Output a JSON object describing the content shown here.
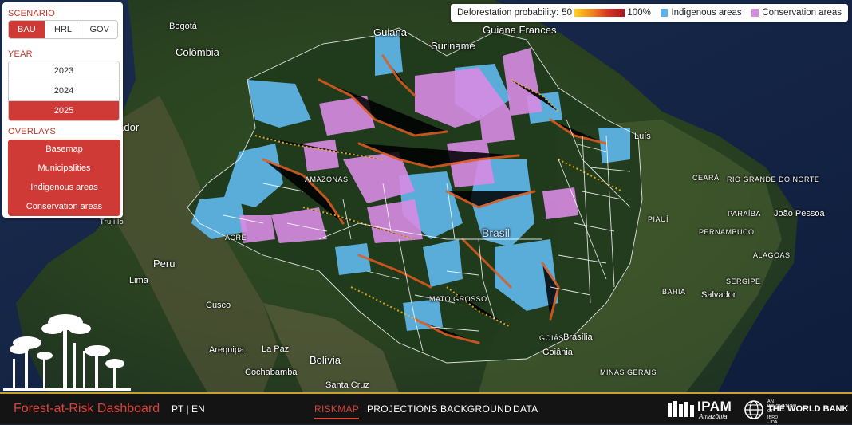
{
  "panel": {
    "scenario": {
      "title": "SCENARIO",
      "options": [
        "BAU",
        "HRL",
        "GOV"
      ],
      "selected": "BAU"
    },
    "year": {
      "title": "YEAR",
      "options": [
        "2023",
        "2024",
        "2025"
      ],
      "selected": "2025"
    },
    "overlays": {
      "title": "OVERLAYS",
      "items": [
        "Basemap",
        "Municipalities",
        "Indigenous areas",
        "Conservation areas"
      ]
    }
  },
  "legend": {
    "label": "Deforestation probability:",
    "min": "50",
    "max": "100%",
    "indigenous": "Indigenous areas",
    "conservation": "Conservation areas",
    "colors": {
      "low": "#ffd21a",
      "mid": "#f28a1e",
      "high": "#a8161c",
      "indigenous": "#5eb3e4",
      "conservation": "#d98be3"
    }
  },
  "map_labels": {
    "guiana": "Guiana",
    "suriname": "Suriname",
    "guiana_francesa": "Guiana Frances",
    "bogota": "Bogotá",
    "colombia": "Colômbia",
    "equador": "Equador",
    "peru": "Peru",
    "lima": "Lima",
    "cusco": "Cusco",
    "arequipa": "Arequipa",
    "la_paz": "La Paz",
    "bolivia": "Bolívia",
    "cochabamba": "Cochabamba",
    "santa_cruz": "Santa Cruz",
    "brasil": "Brasil",
    "brasilia": "Brasília",
    "goiania": "Goiânia",
    "goias": "GOIÁS",
    "minas_gerais": "MINAS GERAIS",
    "bahia": "BAHIA",
    "salvador": "Salvador",
    "sergipe": "SERGIPE",
    "alagoas": "ALAGOAS",
    "pernambuco": "PERNAMBUCO",
    "paraiba": "PARAÍBA",
    "joao_pessoa": "João Pessoa",
    "rio_grande_do_norte": "RIO GRANDE DO NORTE",
    "ceara": "CEARÁ",
    "piaui": "PIAUÍ",
    "luis": "Luís",
    "amazonas": "AMAZONAS",
    "mato_grosso": "MATO GROSSO",
    "acre": "ACRE",
    "trujillo": "Trujillo"
  },
  "footer": {
    "title": "Forest-at-Risk Dashboard",
    "lang_pt": "PT",
    "lang_sep": "|",
    "lang_en": "EN",
    "nav": [
      "RISKMAP",
      "PROJECTIONS",
      "BACKGROUND",
      "DATA"
    ],
    "active_nav": "RISKMAP",
    "ipam_name": "IPAM",
    "ipam_sub": "Amazônia",
    "wb_small": "AN INNOVATION OF",
    "wb_name": "THE WORLD BANK",
    "wb_sub": "IBRD · IDA"
  }
}
